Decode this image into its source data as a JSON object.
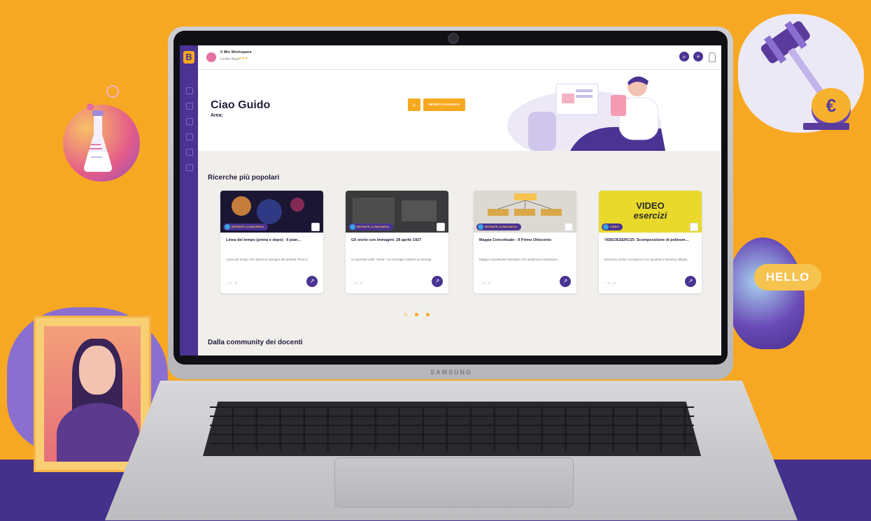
{
  "workspace": {
    "title": "Il Mio Workspace",
    "subtitle": "Livello Base",
    "stars": "★★★"
  },
  "topbar": {
    "search_icon": "search-icon",
    "add_icon": "plus-icon",
    "notifications_icon": "bell-icon"
  },
  "hero": {
    "greeting": "Ciao Guido",
    "area_label": "Area:",
    "search_icon_glyph": "⌕",
    "cta_label": "RICERCA AVANZATA"
  },
  "popular": {
    "title": "Ricerche più popolari",
    "cards": [
      {
        "badge": "ENTRATE LA BACHECA",
        "title": "Linea del tempo (prima e dopo) - Il pian...",
        "desc": "Linea del tempo che illustra lo sviluppo del pianeta Terra d...",
        "meta": "♡ 0   ◌ 0"
      },
      {
        "badge": "ENTRATE LA BACHECA",
        "title": "Gli storie con immagini: 28 aprile 1927",
        "desc": "Un giornale sulle \"storie\" con immagini relative al mitologi...",
        "meta": "♡ 0   ◌ 0"
      },
      {
        "badge": "ENTRATE LA BACHECA",
        "title": "Mappa Concettuale - Il Primo Ottocento",
        "desc": "Mappa concettuale interattiva che analizza la variazione...",
        "meta": "♡ 0   ◌ 0"
      },
      {
        "badge": "VIDEO",
        "title": "VIDEOESERCIZI: Scomposizione di polinom...",
        "desc": "Esercizio svolto: scomponi in un quadrato il binomio allegat...",
        "meta": "♡ 0   ◌ 0",
        "thumb_text_1": "VIDEO",
        "thumb_text_2": "esercizi"
      }
    ]
  },
  "community": {
    "title": "Dalla community dei docenti"
  },
  "laptop": {
    "brand": "SAMSUNG"
  },
  "decor": {
    "hello_label": "HELLO",
    "euro_symbol": "€"
  },
  "colors": {
    "background": "#f7a823",
    "band": "#43318c",
    "sidebar": "#4a3393",
    "accent": "#f6a91f"
  },
  "carousel": {
    "active_index": 1,
    "count": 3
  }
}
